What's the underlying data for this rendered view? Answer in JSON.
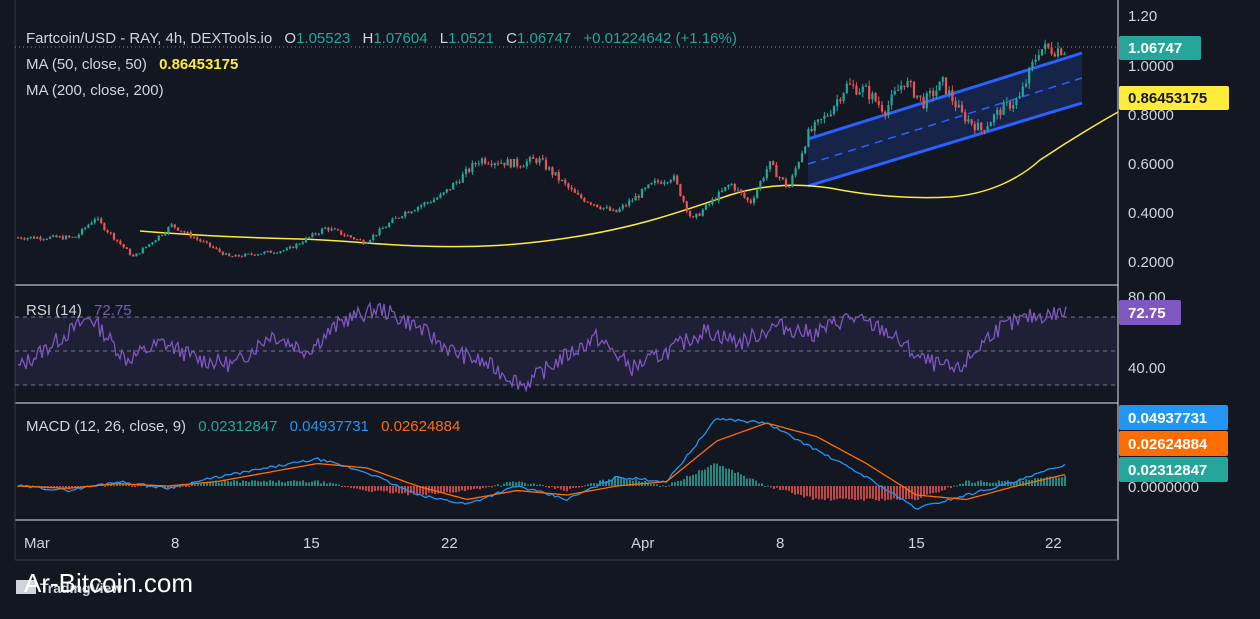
{
  "header": {
    "symbol": "Fartcoin/USD - RAY, 4h, DEXTools.io",
    "o_label": "O",
    "o_value": "1.05523",
    "h_label": "H",
    "h_value": "1.07604",
    "l_label": "L",
    "l_value": "1.0521",
    "c_label": "C",
    "c_value": "1.06747",
    "change": "+0.01224642 (+1.16%)"
  },
  "indicators": {
    "ma50": {
      "label": "MA (50, close, 50)",
      "value": "0.86453175"
    },
    "ma200": {
      "label": "MA (200, close, 200)"
    },
    "rsi": {
      "label": "RSI (14)",
      "value": "72.75"
    },
    "macd": {
      "label": "MACD (12, 26, close, 9)",
      "hist": "0.02312847",
      "macd": "0.04937731",
      "signal": "0.02624884"
    }
  },
  "price_badges": {
    "last": "1.06747",
    "ma50": "0.86453175"
  },
  "macd_badges": {
    "macd": "0.04937731",
    "signal": "0.02624884",
    "hist": "0.02312847"
  },
  "rsi_badge": "72.75",
  "watermark": "Ar-Bitcoin.com",
  "tv_logo": "TradingView",
  "colors": {
    "up": "#26a69a",
    "down": "#ef5350",
    "ma50": "#ffeb3b",
    "rsi": "#7e57c2",
    "macd": "#2196f3",
    "signal": "#ff6d00",
    "channel": "#2962ff",
    "bg": "#131722"
  },
  "chart_data": [
    {
      "type": "candlestick",
      "title": "Fartcoin/USD 4h",
      "price_axis_ticks": [
        "1.20",
        "1.0000",
        "0.8000",
        "0.6000",
        "0.4000",
        "0.2000"
      ],
      "ylim": [
        0.1,
        1.2
      ],
      "x_ticks": [
        "Mar",
        "8",
        "15",
        "22",
        "Apr",
        "8",
        "15",
        "22"
      ],
      "close_path": [
        {
          "x": "Mar 1",
          "y": 0.3
        },
        {
          "x": "Mar 3",
          "y": 0.3
        },
        {
          "x": "Mar 4",
          "y": 0.38
        },
        {
          "x": "Mar 6",
          "y": 0.22
        },
        {
          "x": "Mar 8",
          "y": 0.35
        },
        {
          "x": "Mar 11",
          "y": 0.22
        },
        {
          "x": "Mar 14",
          "y": 0.25
        },
        {
          "x": "Mar 16",
          "y": 0.34
        },
        {
          "x": "Mar 18",
          "y": 0.28
        },
        {
          "x": "Mar 20",
          "y": 0.4
        },
        {
          "x": "Mar 22",
          "y": 0.47
        },
        {
          "x": "Mar 24",
          "y": 0.62
        },
        {
          "x": "Mar 26",
          "y": 0.6
        },
        {
          "x": "Mar 27",
          "y": 0.62
        },
        {
          "x": "Mar 29",
          "y": 0.47
        },
        {
          "x": "Mar 31",
          "y": 0.4
        },
        {
          "x": "Apr 2",
          "y": 0.52
        },
        {
          "x": "Apr 3",
          "y": 0.55
        },
        {
          "x": "Apr 4",
          "y": 0.37
        },
        {
          "x": "Apr 6",
          "y": 0.52
        },
        {
          "x": "Apr 7",
          "y": 0.44
        },
        {
          "x": "Apr 8",
          "y": 0.6
        },
        {
          "x": "Apr 9",
          "y": 0.5
        },
        {
          "x": "Apr 10",
          "y": 0.72
        },
        {
          "x": "Apr 11",
          "y": 0.8
        },
        {
          "x": "Apr 12",
          "y": 0.92
        },
        {
          "x": "Apr 13",
          "y": 0.9
        },
        {
          "x": "Apr 14",
          "y": 0.82
        },
        {
          "x": "Apr 15",
          "y": 0.94
        },
        {
          "x": "Apr 16",
          "y": 0.85
        },
        {
          "x": "Apr 17",
          "y": 0.93
        },
        {
          "x": "Apr 18",
          "y": 0.8
        },
        {
          "x": "Apr 19",
          "y": 0.74
        },
        {
          "x": "Apr 20",
          "y": 0.82
        },
        {
          "x": "Apr 21",
          "y": 0.87
        },
        {
          "x": "Apr 22",
          "y": 1.07
        }
      ],
      "ma50_series": [
        {
          "x": "Mar 8",
          "y": 0.32
        },
        {
          "x": "Mar 15",
          "y": 0.3
        },
        {
          "x": "Mar 22",
          "y": 0.27
        },
        {
          "x": "Mar 29",
          "y": 0.3
        },
        {
          "x": "Apr 1",
          "y": 0.35
        },
        {
          "x": "Apr 5",
          "y": 0.46
        },
        {
          "x": "Apr 8",
          "y": 0.51
        },
        {
          "x": "Apr 11",
          "y": 0.47
        },
        {
          "x": "Apr 15",
          "y": 0.46
        },
        {
          "x": "Apr 18",
          "y": 0.51
        },
        {
          "x": "Apr 20",
          "y": 0.58
        },
        {
          "x": "Apr 22",
          "y": 0.73
        },
        {
          "x": "Apr 23",
          "y": 0.86
        }
      ],
      "channel": {
        "upper": [
          {
            "x": "Apr 9",
            "y": 0.7
          },
          {
            "x": "Apr 23",
            "y": 1.05
          }
        ],
        "middle": [
          {
            "x": "Apr 9",
            "y": 0.6
          },
          {
            "x": "Apr 23",
            "y": 0.95
          }
        ],
        "lower": [
          {
            "x": "Apr 9",
            "y": 0.51
          },
          {
            "x": "Apr 23",
            "y": 0.84
          }
        ]
      }
    },
    {
      "type": "line",
      "title": "RSI (14)",
      "ticks": [
        "80.00",
        "40.00"
      ],
      "ylim": [
        20,
        85
      ],
      "levels": [
        70,
        50,
        30
      ],
      "series": [
        {
          "name": "RSI",
          "values": [
            40,
            55,
            70,
            45,
            55,
            45,
            42,
            60,
            50,
            68,
            75,
            65,
            50,
            42,
            30,
            45,
            58,
            40,
            50,
            62,
            55,
            65,
            60,
            70,
            62,
            45,
            38,
            62,
            70,
            72.75
          ]
        }
      ]
    },
    {
      "type": "line",
      "title": "MACD (12, 26, close, 9)",
      "ticks": [
        "0.0000000"
      ],
      "series": [
        {
          "name": "MACD",
          "values": [
            0,
            -0.01,
            0.01,
            -0.005,
            0.02,
            0.04,
            0.06,
            0.03,
            -0.02,
            -0.04,
            0.0,
            -0.03,
            0.02,
            0.01,
            0.15,
            0.14,
            0.08,
            0.02,
            -0.05,
            -0.02,
            0.01,
            0.049
          ]
        },
        {
          "name": "Signal",
          "values": [
            0,
            -0.005,
            0.005,
            0.0,
            0.01,
            0.03,
            0.05,
            0.04,
            0.0,
            -0.03,
            -0.01,
            -0.02,
            0.0,
            0.01,
            0.1,
            0.14,
            0.11,
            0.05,
            -0.02,
            -0.03,
            0.0,
            0.026
          ]
        }
      ]
    }
  ]
}
